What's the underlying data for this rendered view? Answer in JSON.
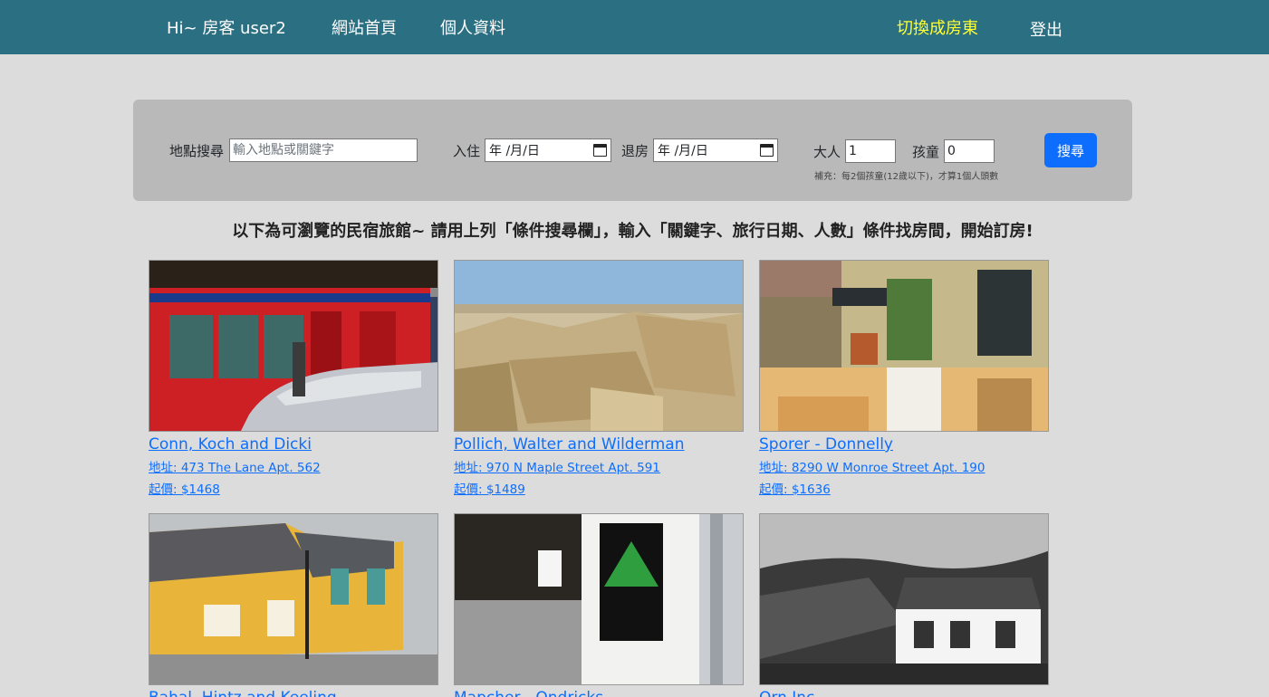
{
  "nav": {
    "greeting": "Hi~ 房客 user2",
    "home": "網站首頁",
    "profile": "個人資料",
    "switch_role": "切換成房東",
    "logout": "登出",
    "bg_color": "#2b6f82",
    "accent_color": "#ffff33"
  },
  "search": {
    "location_label": "地點搜尋",
    "location_placeholder": "輸入地點或關鍵字",
    "checkin_label": "入住",
    "checkin_value": "年 /月/日",
    "checkout_label": "退房",
    "checkout_value": "年 /月/日",
    "adults_label": "大人",
    "adults_value": "1",
    "children_label": "孩童",
    "children_value": "0",
    "note": "補充：每2個孩童(12歲以下)，才算1個人頭數",
    "button": "搜尋"
  },
  "intro": "以下為可瀏覽的民宿旅館~ 請用上列「條件搜尋欄」，輸入「關鍵字、旅行日期、人數」條件找房間，開始訂房!",
  "listings": [
    {
      "name": "Conn, Koch and Dicki",
      "address": "地址: 473 The Lane Apt. 562",
      "price": "起價: $1468",
      "image": "red-pub-storefront"
    },
    {
      "name": "Pollich, Walter and Wilderman",
      "address": "地址: 970 N Maple Street Apt. 591",
      "price": "起價: $1489",
      "image": "stone-ruins"
    },
    {
      "name": "Sporer - Donnelly",
      "address": "地址: 8290 W Monroe Street Apt. 190",
      "price": "起價: $1636",
      "image": "hostel-courtyard"
    },
    {
      "name": "Bahal, Hintz and Keeling",
      "image": "yellow-hostel"
    },
    {
      "name": "Mapcher - Ondricks",
      "image": "hostel-door"
    },
    {
      "name": "Orn Inc",
      "image": "white-cottage"
    }
  ]
}
